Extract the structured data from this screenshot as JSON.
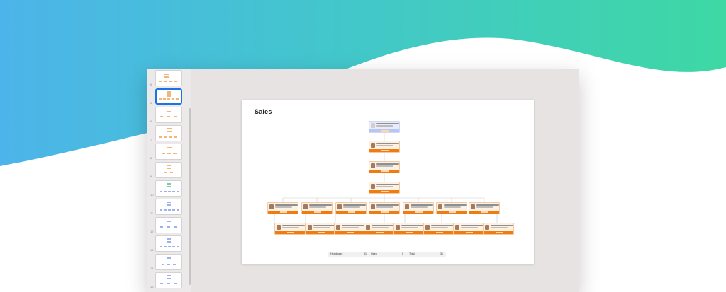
{
  "background": {
    "gradient_left": "#4db3e9",
    "gradient_right": "#3ed6a8"
  },
  "sidebar": {
    "items": [
      {
        "number": "6",
        "selected": false
      },
      {
        "number": "6",
        "selected": true
      },
      {
        "number": "6",
        "selected": false
      },
      {
        "number": "7",
        "selected": false
      },
      {
        "number": "8",
        "selected": false
      },
      {
        "number": "9",
        "selected": false
      },
      {
        "number": "10",
        "selected": false
      },
      {
        "number": "11",
        "selected": false
      },
      {
        "number": "12",
        "selected": false
      },
      {
        "number": "13",
        "selected": false
      },
      {
        "number": "14",
        "selected": false
      },
      {
        "number": "15",
        "selected": false
      }
    ],
    "accent": "#1a73e8"
  },
  "slide": {
    "title": "Sales",
    "card_accent": "#f07c10",
    "footer": {
      "headcount_label": "Headcount",
      "headcount_value": "31",
      "open_label": "Open",
      "open_value": "0",
      "total_label": "Total",
      "total_value": "31"
    }
  }
}
